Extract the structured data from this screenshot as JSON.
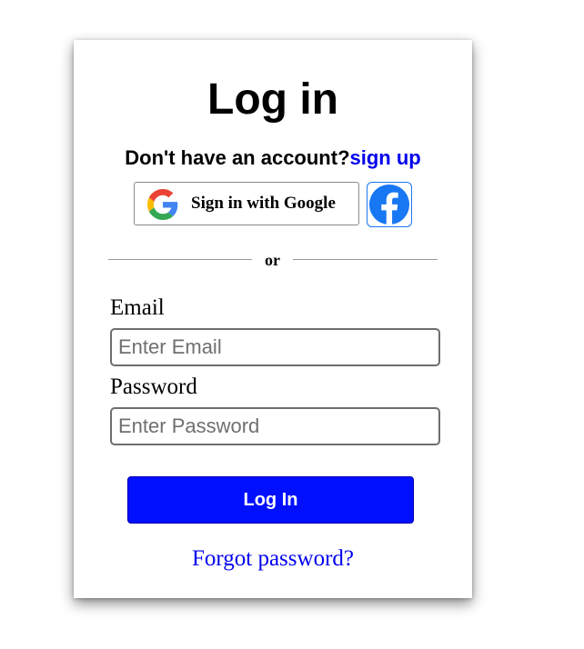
{
  "login": {
    "title": "Log in",
    "signup_prompt": "Don't have an account?",
    "signup_link": "sign up",
    "google_button": "Sign in with Google",
    "or": "or",
    "email_label": "Email",
    "email_placeholder": "Enter Email",
    "email_value": "",
    "password_label": "Password",
    "password_placeholder": "Enter Password",
    "password_value": "",
    "submit_button": "Log In",
    "forgot_link": "Forgot password?"
  },
  "icons": {
    "google": "google-logo-icon",
    "facebook": "facebook-logo-icon"
  },
  "colors": {
    "primary_button": "#0010ff",
    "link": "#0000ee",
    "facebook": "#1877f2"
  }
}
